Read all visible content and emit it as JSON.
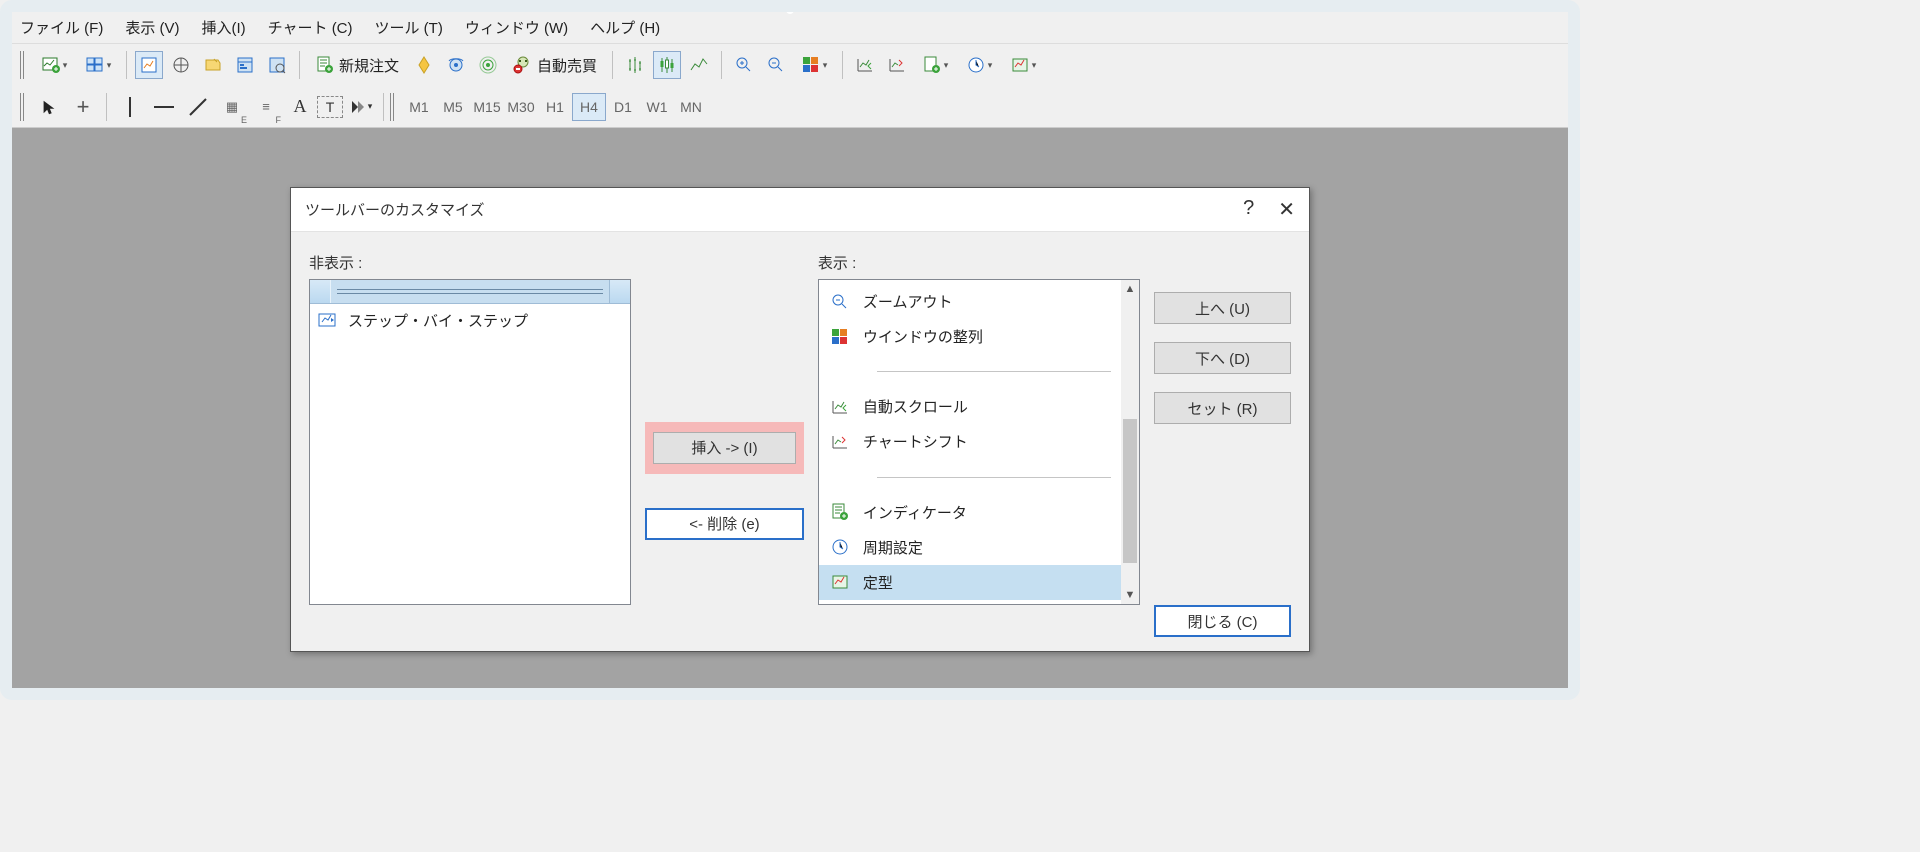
{
  "menu": {
    "file": "ファイル (F)",
    "view": "表示 (V)",
    "insert": "挿入(I)",
    "chart": "チャート (C)",
    "tools": "ツール (T)",
    "window": "ウィンドウ (W)",
    "help": "ヘルプ (H)"
  },
  "toolbar": {
    "new_order": "新規注文",
    "auto_trading": "自動売買"
  },
  "timeframes": {
    "m1": "M1",
    "m5": "M5",
    "m15": "M15",
    "m30": "M30",
    "h1": "H1",
    "h4": "H4",
    "d1": "D1",
    "w1": "W1",
    "mn": "MN",
    "active": "H4"
  },
  "draw": {
    "text_A": "A",
    "text_T": "T",
    "fib_E": "E",
    "fib_F": "F"
  },
  "dialog": {
    "title": "ツールバーのカスタマイズ",
    "help": "?",
    "close_x": "✕",
    "left_label": "非表示 :",
    "right_label": "表示 :",
    "left_items": [
      {
        "label": "ステップ・バイ・ステップ",
        "icon": "step"
      }
    ],
    "right_items": [
      {
        "label": "ズームアウト",
        "icon": "zoom-out"
      },
      {
        "label": "ウインドウの整列",
        "icon": "tile"
      },
      {
        "sep": true
      },
      {
        "label": "自動スクロール",
        "icon": "autoscroll"
      },
      {
        "label": "チャートシフト",
        "icon": "chart-shift"
      },
      {
        "sep": true
      },
      {
        "label": "インディケータ",
        "icon": "indicator"
      },
      {
        "label": "周期設定",
        "icon": "clock"
      },
      {
        "label": "定型",
        "icon": "template",
        "selected": true
      }
    ],
    "btn_insert": "挿入 -> (I)",
    "btn_remove": "<- 削除 (e)",
    "btn_up": "上へ (U)",
    "btn_down": "下へ (D)",
    "btn_reset": "セット (R)",
    "btn_close": "閉じる (C)"
  }
}
